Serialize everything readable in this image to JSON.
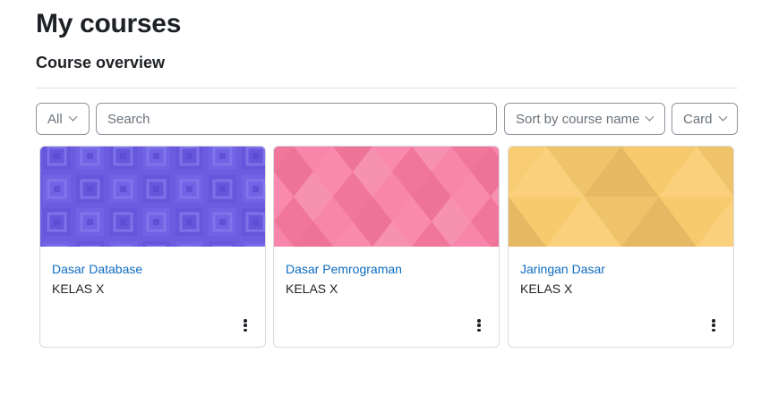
{
  "page": {
    "title": "My courses"
  },
  "overview": {
    "title": "Course overview",
    "filter": {
      "value": "All"
    },
    "search": {
      "placeholder": "Search",
      "value": ""
    },
    "sort": {
      "value": "Sort by course name"
    },
    "view": {
      "value": "Card"
    }
  },
  "courses": [
    {
      "name": "Dasar Database",
      "category": "KELAS X",
      "pattern": "squares",
      "color": "#6b5ce0",
      "menu_icon": "vertical-ellipsis-icon"
    },
    {
      "name": "Dasar Pemrograman",
      "category": "KELAS X",
      "pattern": "diamonds",
      "color": "#f77fa5",
      "menu_icon": "vertical-ellipsis-icon"
    },
    {
      "name": "Jaringan Dasar",
      "category": "KELAS X",
      "pattern": "triangles",
      "color": "#f8cd72",
      "menu_icon": "vertical-ellipsis-icon"
    }
  ],
  "colors": {
    "link": "#0f6cbf",
    "border": "#8f959e",
    "text": "#1d2125"
  }
}
